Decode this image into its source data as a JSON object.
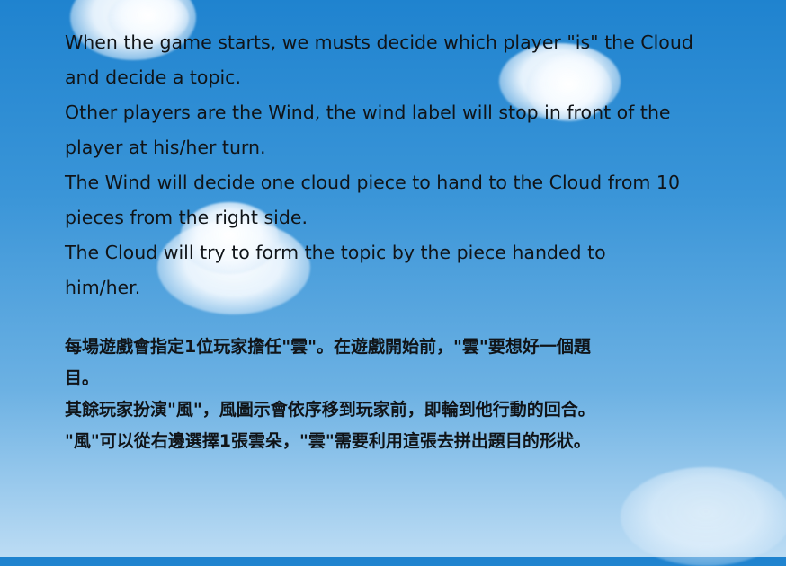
{
  "instructions": {
    "english": [
      "When the game starts, we musts decide which player \"is\" the Cloud",
      "and decide a topic.",
      "Other players are the Wind, the wind label will stop in front of the",
      "player at his/her turn.",
      "The Wind will decide one cloud piece to hand to the Cloud  from 10",
      "pieces from the right side.",
      "The Cloud will try to form the topic by the piece handed to",
      "him/her."
    ],
    "chinese": [
      "每場遊戲會指定1位玩家擔任\"雲\"。在遊戲開始前，\"雲\"要想好一個題",
      "目。",
      "其餘玩家扮演\"風\"，風圖示會依序移到玩家前，即輪到他行動的回合。",
      "\"風\"可以從右邊選擇1張雲朵，\"雲\"需要利用這張去拼出題目的形狀。"
    ]
  }
}
